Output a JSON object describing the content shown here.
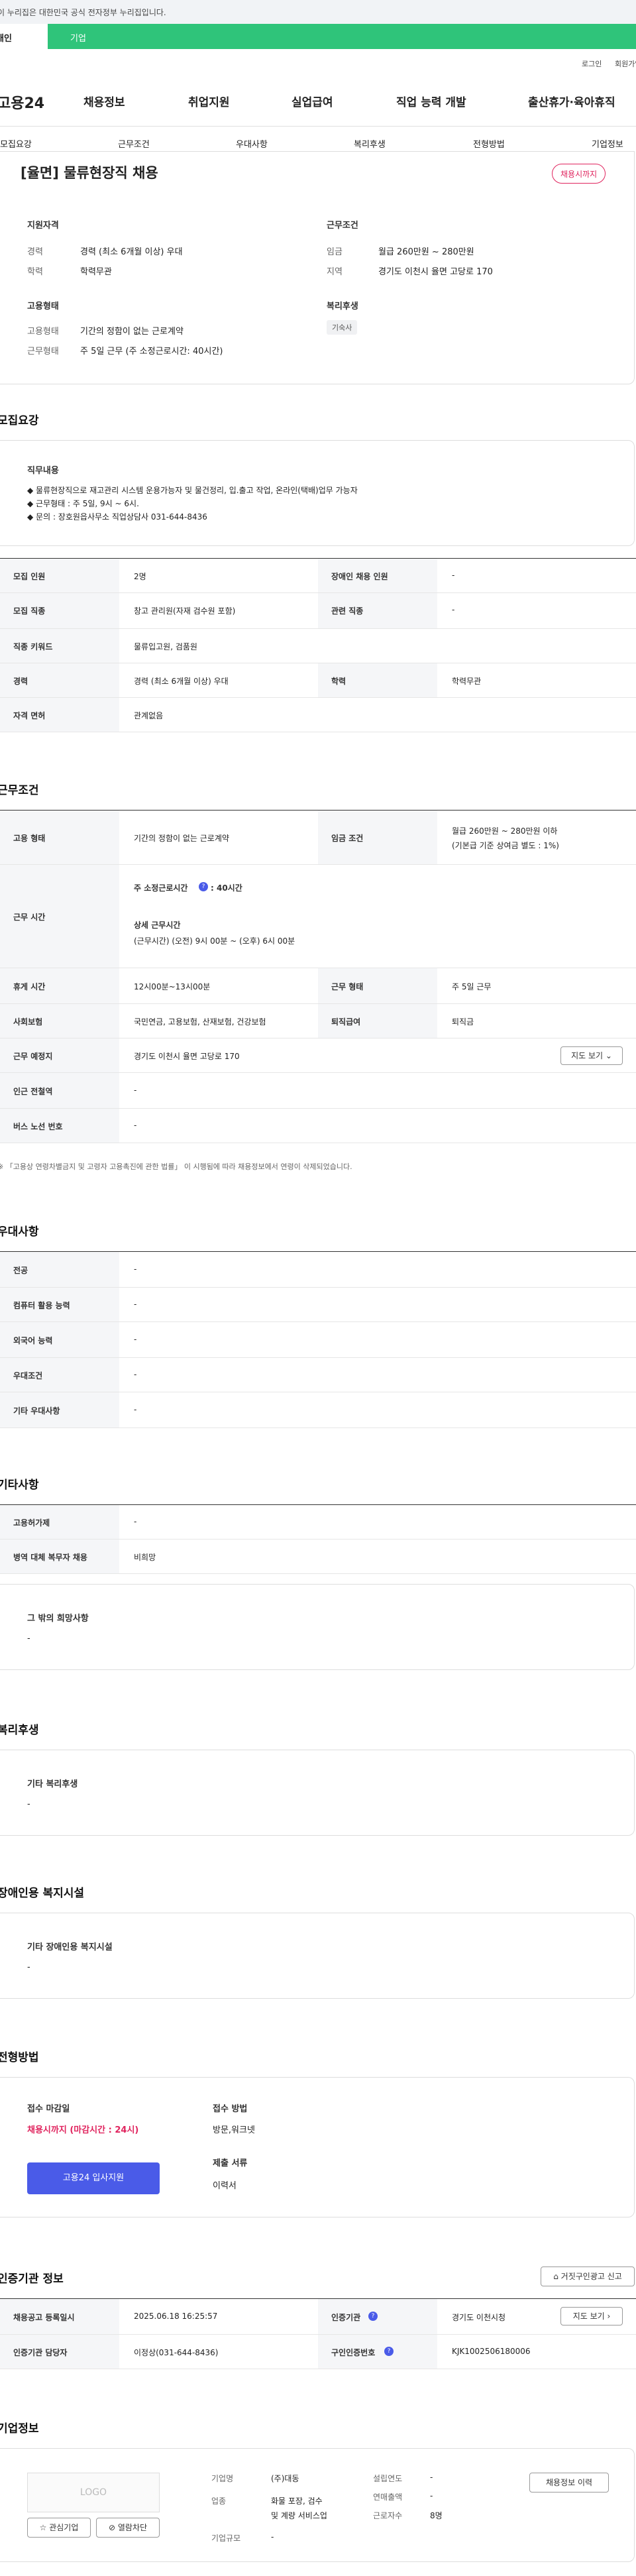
{
  "gov_banner": "이 누리집은 대한민국 공식 전자정부 누리집입니다.",
  "tabs": {
    "personal": "개인",
    "company": "기업"
  },
  "util": {
    "login": "로그인",
    "join": "회원가입"
  },
  "brand": "고용24",
  "gnb": [
    "채용정보",
    "취업지원",
    "실업급여",
    "직업 능력 개발",
    "출산휴가·육아휴직"
  ],
  "subnav": [
    "모집요강",
    "근무조건",
    "우대사항",
    "복리후생",
    "전형방법",
    "기업정보"
  ],
  "job": {
    "title": "[율면] 물류현장직 채용",
    "badge": "채용시까지",
    "qual_title": "지원자격",
    "career_l": "경력",
    "career_v": "경력 (최소 6개월 이상) 우대",
    "edu_l": "학력",
    "edu_v": "학력무관",
    "emp_title": "고용형태",
    "emp_l": "고용형태",
    "emp_v": "기간의 정함이 없는 근로계약",
    "work_l": "근무형태",
    "work_v": "주 5일 근무 (주 소정근로시간: 40시간)",
    "cond_title": "근무조건",
    "wage_l": "임금",
    "wage_v": "월급 260만원 ~ 280만원",
    "loc_l": "지역",
    "loc_v": "경기도 이천시 율면 고당로 170",
    "ben_title": "복리후생",
    "ben_tag": "기숙사"
  },
  "recruit": {
    "title": "모집요강",
    "duty_title": "직무내용",
    "duty_lines": [
      "◆ 물류현장직으로 재고관리 시스템 운용가능자 및 물건정리, 입.출고 작업, 온라인(택배)업무 가능자",
      "◆ 근무형태 : 주 5일, 9시 ~ 6시.",
      "◆ 문의 : 장호원읍사무소 직업상담사 031-644-8436"
    ],
    "rows": [
      [
        "모집 인원",
        "2명",
        "장애인 채용 인원",
        "-"
      ],
      [
        "모집 직종",
        "창고 관리원(자재 검수원 포함)",
        "관련 직종",
        "-"
      ],
      [
        "직종 키워드",
        "물류입고원, 검품원",
        "",
        ""
      ],
      [
        "경력",
        "경력 (최소 6개월 이상) 우대",
        "학력",
        "학력무관"
      ],
      [
        "자격 면허",
        "관계없음",
        "",
        ""
      ]
    ]
  },
  "work": {
    "title": "근무조건",
    "emp_l": "고용 형태",
    "emp_v": "기간의 정함이 없는 근로계약",
    "wage_l": "임금 조건",
    "wage_v1": "월급 260만원 ~ 280만원 이하",
    "wage_v2": "(기본급 기준 상여금 별도 : 1%)",
    "time_l": "근무 시간",
    "time_head": "주 소정근로시간",
    "time_hours": ": 40시간",
    "time_detail_t": "상세 근무시간",
    "time_detail_v": "(근무시간) (오전) 9시 00분 ~ (오후) 6시 00분",
    "rest_l": "휴게 시간",
    "rest_v": "12시00분~13시00분",
    "form_l": "근무 형태",
    "form_v": "주 5일 근무",
    "ins_l": "사회보험",
    "ins_v": "국민연금, 고용보험, 산재보험, 건강보험",
    "sev_l": "퇴직급여",
    "sev_v": "퇴직금",
    "place_l": "근무 예정지",
    "place_v": "경기도 이천시 율면 고당로 170",
    "map_btn": "지도 보기",
    "sub_l": "인근 전철역",
    "sub_v": "-",
    "bus_l": "버스 노선 번호",
    "bus_v": "-",
    "note": "「고용상 연령차별금지 및 고령자 고용촉진에 관한 법률」 이 시행됨에 따라 채용정보에서 연령이 삭제되었습니다."
  },
  "pref": {
    "title": "우대사항",
    "rows": [
      [
        "전공",
        "-"
      ],
      [
        "컴퓨터 활용 능력",
        "-"
      ],
      [
        "외국어 능력",
        "-"
      ],
      [
        "우대조건",
        "-"
      ],
      [
        "기타 우대사항",
        "-"
      ]
    ]
  },
  "etc": {
    "title": "기타사항",
    "rows": [
      [
        "고용허가제",
        "-"
      ],
      [
        "병역 대체 복무자 채용",
        "비희망"
      ]
    ],
    "wish_t": "그 밖의 희망사항",
    "wish_v": "-"
  },
  "welfare": {
    "title": "복리후생",
    "box_t": "기타 복리후생",
    "box_v": "-"
  },
  "disab": {
    "title": "장애인용 복지시설",
    "box_t": "기타 장애인용 복지시설",
    "box_v": "-"
  },
  "select": {
    "title": "전형방법",
    "deadline_t": "접수 마감일",
    "deadline_v": "채용시까지 (마감시간 : 24시)",
    "apply_btn": "고용24 입사지원",
    "method_t": "접수 방법",
    "method_v": "방문,워크넷",
    "docs_t": "제출 서류",
    "docs_v": "이력서"
  },
  "cert": {
    "title": "인증기관 정보",
    "report_btn": "거짓구인광고 신고",
    "rows": [
      [
        "채용공고 등록일시",
        "2025.06.18 16:25:57",
        "인증기관",
        "경기도 이천시청"
      ],
      [
        "인증기관 담당자",
        "이정상(031-644-8436)",
        "구인인증번호",
        "KJK1002506180006"
      ]
    ],
    "map_btn": "지도 보기"
  },
  "company": {
    "title": "기업정보",
    "logo": "LOGO",
    "fav_btn": "관심기업",
    "block_btn": "열람차단",
    "name_l": "기업명",
    "name_v": "(주)대동",
    "ind_l": "업종",
    "ind_v1": "화물 포장, 검수",
    "ind_v2": "및 계량 서비스업",
    "scale_l": "기업규모",
    "scale_v": "-",
    "year_l": "설립연도",
    "year_v": "-",
    "rev_l": "연매출액",
    "rev_v": "-",
    "emp_l": "근로자수",
    "emp_v": "8명",
    "hist_btn": "채용정보 이력"
  },
  "colors": {
    "green": "#2fc47a",
    "accent": "#e0245e",
    "blue": "#4a5be8"
  }
}
